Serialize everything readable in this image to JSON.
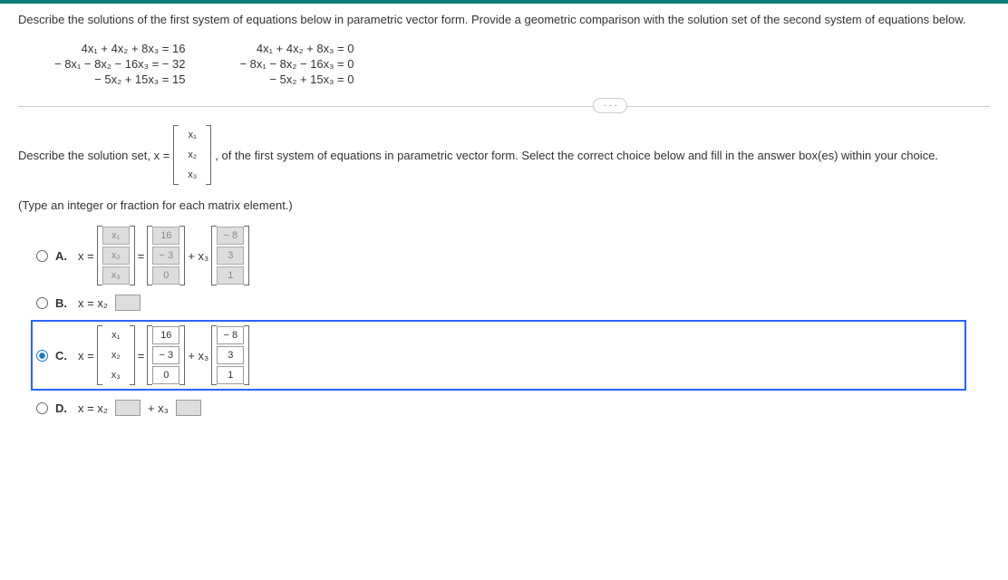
{
  "description": "Describe the solutions of the first system of equations below in parametric vector form. Provide a geometric comparison with the solution set of the second system of equations below.",
  "system1": {
    "line1": "4x₁ + 4x₂ + 8x₃ = 16",
    "line2": "− 8x₁ − 8x₂ − 16x₃ = − 32",
    "line3": "− 5x₂ + 15x₃ = 15"
  },
  "system2": {
    "line1": "4x₁ + 4x₂ + 8x₃ = 0",
    "line2": "− 8x₁ − 8x₂ − 16x₃ = 0",
    "line3": "− 5x₂ + 15x₃ = 0"
  },
  "dots": "· · ·",
  "question_pre": "Describe the solution set, x =",
  "vec": {
    "r1": "x₁",
    "r2": "x₂",
    "r3": "x₃"
  },
  "question_post": ", of the first system of equations in parametric vector form. Select the correct choice below and fill in the answer box(es) within your choice.",
  "hint": "(Type an integer or fraction for each matrix element.)",
  "choiceA": {
    "label": "A.",
    "prefix": "x =",
    "left": {
      "r1": "x₁",
      "r2": "x₂",
      "r3": "x₃"
    },
    "eq": "=",
    "mid": {
      "r1": "16",
      "r2": "− 3",
      "r3": "0"
    },
    "plus": "+ x₃",
    "right": {
      "r1": "− 8",
      "r2": "3",
      "r3": "1"
    }
  },
  "choiceB": {
    "label": "B.",
    "text": "x = x₂"
  },
  "choiceC": {
    "label": "C.",
    "prefix": "x =",
    "left": {
      "r1": "x₁",
      "r2": "x₂",
      "r3": "x₃"
    },
    "eq": "=",
    "mid": {
      "r1": "16",
      "r2": "− 3",
      "r3": "0"
    },
    "plus": "+ x₃",
    "right": {
      "r1": "− 8",
      "r2": "3",
      "r3": "1"
    }
  },
  "choiceD": {
    "label": "D.",
    "text_pre": "x = x₂",
    "text_mid": "+ x₃"
  }
}
